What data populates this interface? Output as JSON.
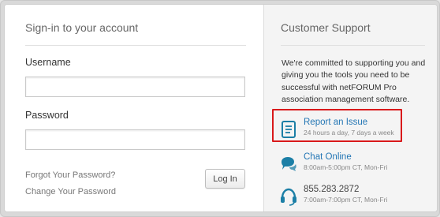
{
  "signin": {
    "heading": "Sign-in to your account",
    "username_label": "Username",
    "username_value": "",
    "password_label": "Password",
    "password_value": "",
    "forgot_password": "Forgot Your Password?",
    "change_password": "Change Your Password",
    "login_button": "Log In"
  },
  "support": {
    "heading": "Customer Support",
    "intro": "We're committed to supporting you and giving you the tools you need to be successful with netFORUM Pro association management software.",
    "items": [
      {
        "title": "Report an Issue",
        "subtitle": "24 hours a day, 7 days a week",
        "icon": "report-issue-icon"
      },
      {
        "title": "Chat Online",
        "subtitle": "8:00am-5:00pm CT, Mon-Fri",
        "icon": "chat-icon"
      },
      {
        "title": "855.283.2872",
        "subtitle": "7:00am-7:00pm CT, Mon-Fri",
        "icon": "headset-icon"
      }
    ]
  },
  "colors": {
    "link_blue": "#2577b5",
    "icon_teal": "#1c7fa6",
    "highlight_red": "#d9191b"
  }
}
